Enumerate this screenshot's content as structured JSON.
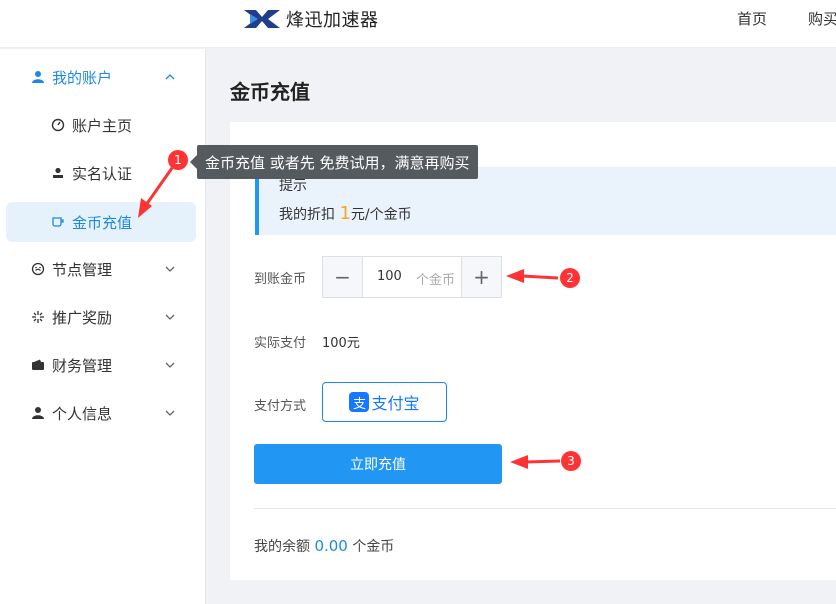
{
  "header": {
    "logo_text": "烽迅加速器",
    "nav": [
      {
        "label": "首页"
      },
      {
        "label": "购买"
      }
    ]
  },
  "sidebar": {
    "items": [
      {
        "label": "我的账户",
        "icon": "user-icon",
        "expanded": true
      },
      {
        "label": "账户主页",
        "icon": "dashboard-icon"
      },
      {
        "label": "实名认证",
        "icon": "person-icon"
      },
      {
        "label": "金币充值",
        "icon": "cup-icon",
        "active": true
      },
      {
        "label": "节点管理",
        "icon": "smile-icon"
      },
      {
        "label": "推广奖励",
        "icon": "sparkle-icon"
      },
      {
        "label": "财务管理",
        "icon": "wallet-icon"
      },
      {
        "label": "个人信息",
        "icon": "user-icon"
      }
    ]
  },
  "main": {
    "title": "金币充值",
    "tip": {
      "title": "提示",
      "text_prefix": "我的折扣",
      "discount": "1",
      "text_suffix": "元/个金币"
    },
    "amount": {
      "label": "到账金币",
      "value": "100",
      "unit": "个金币",
      "minus": "−",
      "plus": "+"
    },
    "actual_pay": {
      "label": "实际支付",
      "value": "100元"
    },
    "pay_method": {
      "label": "支付方式",
      "option": "支付宝",
      "icon_glyph": "支"
    },
    "submit_label": "立即充值",
    "balance": {
      "prefix": "我的余额",
      "value": "0.00",
      "suffix": "个金币"
    }
  },
  "annotations": {
    "tooltip": "金币充值 或者先 免费试用，满意再购买",
    "badges": [
      "1",
      "2",
      "3"
    ]
  },
  "colors": {
    "accent": "#2196f3",
    "discount": "#f5a623",
    "annotation": "#ff3333"
  }
}
